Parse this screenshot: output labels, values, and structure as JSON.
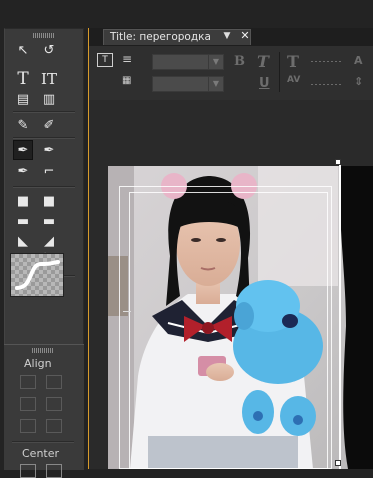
{
  "tools_panel": {
    "tools": [
      {
        "name": "selection-tool-icon",
        "glyph": "↖"
      },
      {
        "name": "rotation-tool-icon",
        "glyph": "↺"
      },
      {
        "name": "type-tool-icon",
        "glyph": "T"
      },
      {
        "name": "vertical-type-tool-icon",
        "glyph": "IT"
      },
      {
        "name": "area-type-tool-icon",
        "glyph": "▤"
      },
      {
        "name": "vertical-area-type-tool-icon",
        "glyph": "▥"
      },
      {
        "name": "path-type-tool-icon",
        "glyph": "✎"
      },
      {
        "name": "vertical-path-type-tool-icon",
        "glyph": "✐"
      },
      {
        "name": "pen-tool-icon",
        "glyph": "✒"
      },
      {
        "name": "delete-anchor-tool-icon",
        "glyph": "✒"
      },
      {
        "name": "add-anchor-tool-icon",
        "glyph": "✒"
      },
      {
        "name": "convert-anchor-tool-icon",
        "glyph": "⌐"
      },
      {
        "name": "rectangle-tool-icon",
        "glyph": "■"
      },
      {
        "name": "clipped-rectangle-tool-icon",
        "glyph": "■"
      },
      {
        "name": "rounded-rectangle-tool-icon",
        "glyph": "▬"
      },
      {
        "name": "rounded-corner-rectangle-tool-icon",
        "glyph": "▬"
      },
      {
        "name": "wedge-tool-icon",
        "glyph": "◣"
      },
      {
        "name": "arc-tool-icon",
        "glyph": "◢"
      },
      {
        "name": "ellipse-tool-icon",
        "glyph": "●"
      },
      {
        "name": "line-tool-icon",
        "glyph": "╲"
      }
    ]
  },
  "align_panel": {
    "align_label": "Align",
    "center_label": "Center"
  },
  "title_window": {
    "tab_label": "Title: перегородка",
    "menu_glyph": "▼",
    "close_glyph": "✕"
  },
  "toolbar": {
    "bold": "B",
    "italic": "T",
    "underline": "U",
    "font_size_icon": "T",
    "kerning_icon": "AV",
    "leading_icon": "A"
  },
  "colors": {
    "accent_border": "#d89b2b",
    "panel_bg": "#3a3a3a",
    "window_bg": "#2b2b2b"
  }
}
